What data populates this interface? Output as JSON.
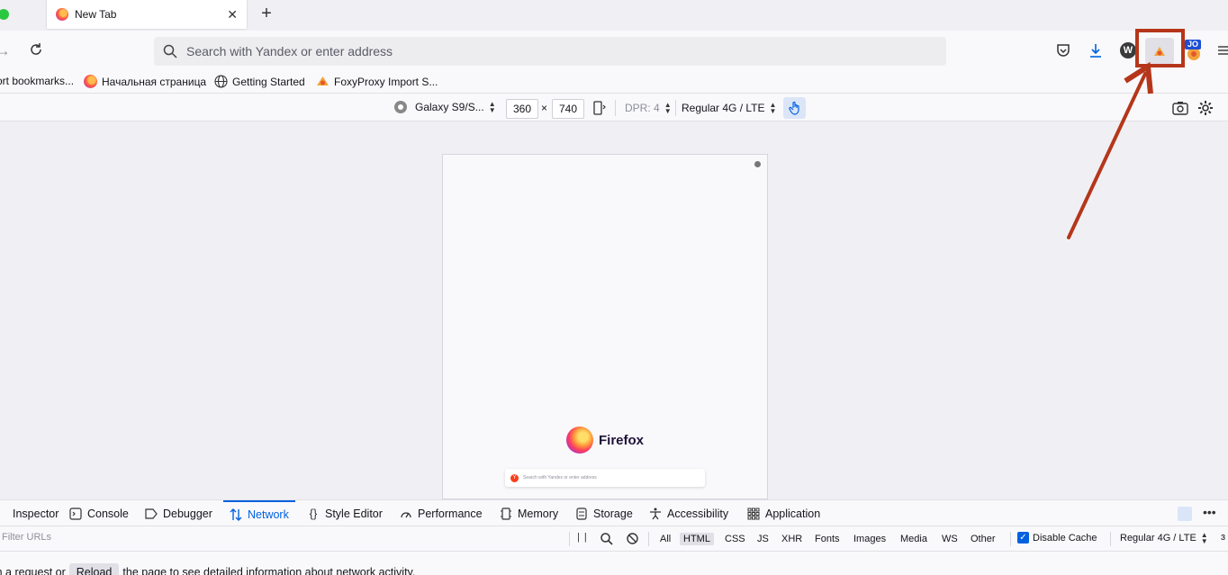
{
  "browser": {
    "tab": {
      "title": "New Tab"
    },
    "urlbar": {
      "placeholder": "Search with Yandex or enter address"
    },
    "extensions": {
      "w_label": "W",
      "jo_badge": "JO"
    },
    "bookmarks": [
      {
        "label": "ort bookmarks..."
      },
      {
        "label": "Начальная страница"
      },
      {
        "label": "Getting Started"
      },
      {
        "label": "FoxyProxy Import S..."
      }
    ]
  },
  "rdm": {
    "device": "Galaxy S9/S...",
    "width": "360",
    "times": "×",
    "height": "740",
    "dpr": "DPR: 4",
    "throttle": "Regular 4G / LTE"
  },
  "viewport": {
    "brand": "Firefox",
    "search_placeholder": "Search with Yandex or enter address",
    "search_logo": "Y"
  },
  "devtools": {
    "tabs": [
      {
        "label": "Inspector",
        "icon": "inspector-icon"
      },
      {
        "label": "Console",
        "icon": "console-icon"
      },
      {
        "label": "Debugger",
        "icon": "debugger-icon"
      },
      {
        "label": "Network",
        "icon": "network-icon",
        "active": true
      },
      {
        "label": "Style Editor",
        "icon": "style-editor-icon"
      },
      {
        "label": "Performance",
        "icon": "performance-icon"
      },
      {
        "label": "Memory",
        "icon": "memory-icon"
      },
      {
        "label": "Storage",
        "icon": "storage-icon"
      },
      {
        "label": "Accessibility",
        "icon": "accessibility-icon"
      },
      {
        "label": "Application",
        "icon": "application-icon"
      }
    ],
    "network": {
      "filter_placeholder": "Filter URLs",
      "pause": "| |",
      "types": [
        "All",
        "HTML",
        "CSS",
        "JS",
        "XHR",
        "Fonts",
        "Images",
        "Media",
        "WS",
        "Other"
      ],
      "selected_type": "HTML",
      "disable_cache": "Disable Cache",
      "throttle": "Regular 4G / LTE",
      "last_glyph": "ɜ",
      "message_pre": "rm a request or",
      "reload": "Reload",
      "message_post": "the page to see detailed information about network activity."
    }
  },
  "colors": {
    "accent": "#0061e0",
    "highlight": "#b5361a"
  }
}
